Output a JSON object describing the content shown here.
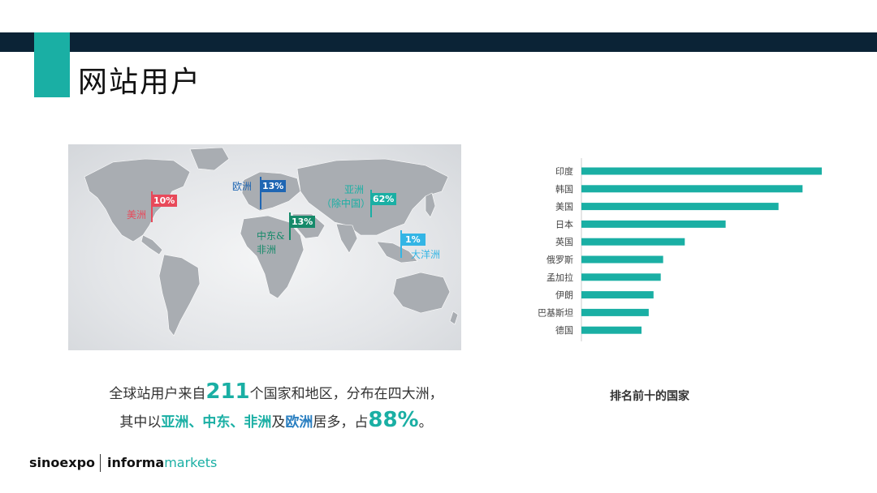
{
  "title": "网站用户",
  "map": {
    "regions": [
      {
        "percent": "10%",
        "label": "美洲",
        "color": "#e8495a"
      },
      {
        "percent": "13%",
        "label": "欧洲",
        "color": "#1f66b3"
      },
      {
        "percent": "13%",
        "label": "中东&",
        "label2": "非洲",
        "color": "#168a6a"
      },
      {
        "percent": "62%",
        "label": "亚洲",
        "label2": "（除中国）",
        "color": "#1aafa4"
      },
      {
        "percent": "1%",
        "label": "大洋洲",
        "color": "#33b5e5"
      }
    ]
  },
  "summary": {
    "line1_prefix": "全球站用户来自",
    "line1_number": "211",
    "line1_suffix": "个国家和地区，分布在四大洲，",
    "line2_prefix": "其中以",
    "line2_hl": "亚洲、中东、非洲",
    "line2_mid": "及",
    "line2_hl2": "欧洲",
    "line2_suffix": "居多，占",
    "line2_number": "88%",
    "line2_end": "。"
  },
  "chart_data": {
    "type": "bar",
    "orientation": "horizontal",
    "categories": [
      "印度",
      "韩国",
      "美国",
      "日本",
      "英国",
      "俄罗斯",
      "孟加拉",
      "伊朗",
      "巴基斯坦",
      "德国"
    ],
    "values": [
      100,
      92,
      82,
      60,
      43,
      34,
      33,
      30,
      28,
      25
    ],
    "color": "#1aafa4",
    "xlabel": "",
    "ylabel": "",
    "caption": "排名前十的国家"
  },
  "logos": {
    "sino": "sinoexpo",
    "informa_a": "informa",
    "informa_b": "markets"
  }
}
